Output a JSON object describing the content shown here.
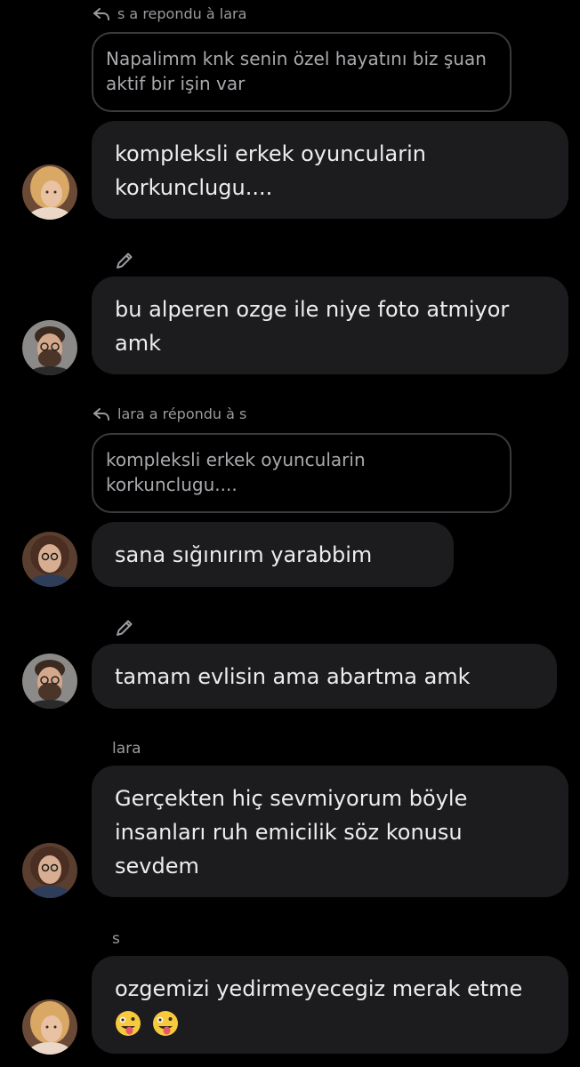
{
  "messages": [
    {
      "reply_header": "s a repondu à lara",
      "quote": "Napalimm knk senin özel hayatını biz şuan aktif bir işin var",
      "text": "kompleksli erkek oyuncularin korkunclugu...."
    },
    {
      "text": "bu alperen ozge ile niye foto atmiyor amk"
    },
    {
      "reply_header": "lara a répondu à s",
      "quote": "kompleksli erkek oyuncularin korkunclugu....",
      "text": "sana sığınırım yarabbim"
    },
    {
      "text": "tamam evlisin ama abartma amk"
    },
    {
      "sender": "lara",
      "text": "Gerçekten hiç sevmiyorum böyle insanları ruh emicilik söz konusu sevdem"
    },
    {
      "sender": "s",
      "text": "ozgemizi yedirmeyecegiz merak etme",
      "emojis": [
        "zany-face-emoji",
        "zany-face-emoji"
      ]
    }
  ],
  "colors": {
    "background": "#000000",
    "bubble": "#1c1c1f",
    "text": "#ededf0",
    "muted": "#9a9aa0"
  }
}
